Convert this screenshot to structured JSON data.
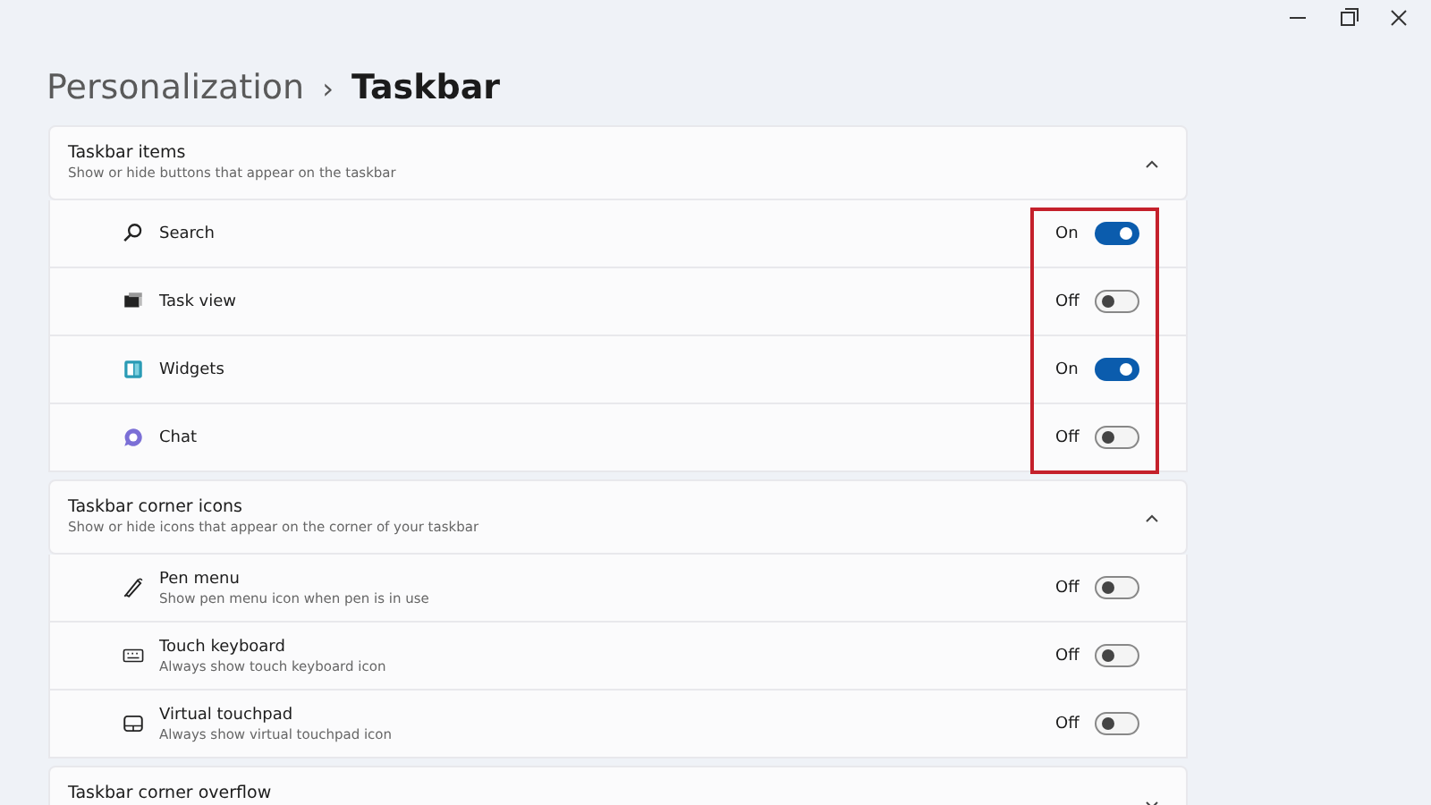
{
  "breadcrumb": {
    "parent": "Personalization",
    "separator": "›",
    "current": "Taskbar"
  },
  "sections": [
    {
      "title": "Taskbar items",
      "subtitle": "Show or hide buttons that appear on the taskbar",
      "expanded": true,
      "items": [
        {
          "kind": "search",
          "label": "Search",
          "state_label": "On",
          "on": true
        },
        {
          "kind": "taskview",
          "label": "Task view",
          "state_label": "Off",
          "on": false
        },
        {
          "kind": "widgets",
          "label": "Widgets",
          "state_label": "On",
          "on": true
        },
        {
          "kind": "chat",
          "label": "Chat",
          "state_label": "Off",
          "on": false
        }
      ]
    },
    {
      "title": "Taskbar corner icons",
      "subtitle": "Show or hide icons that appear on the corner of your taskbar",
      "expanded": true,
      "items": [
        {
          "kind": "pen",
          "label": "Pen menu",
          "description": "Show pen menu icon when pen is in use",
          "state_label": "Off",
          "on": false
        },
        {
          "kind": "keyboard",
          "label": "Touch keyboard",
          "description": "Always show touch keyboard icon",
          "state_label": "Off",
          "on": false
        },
        {
          "kind": "touchpad",
          "label": "Virtual touchpad",
          "description": "Always show virtual touchpad icon",
          "state_label": "Off",
          "on": false
        }
      ]
    },
    {
      "title": "Taskbar corner overflow",
      "expanded": false
    }
  ]
}
